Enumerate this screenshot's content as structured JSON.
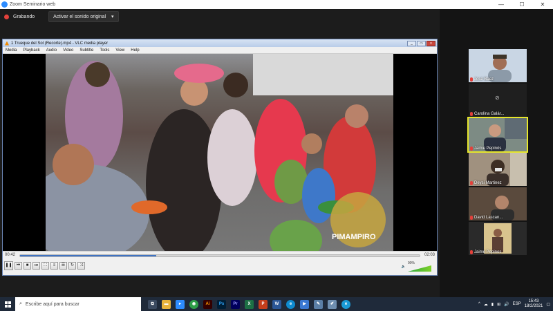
{
  "zoom": {
    "window_title": "Zoom Seminario web",
    "recording_label": "Grabando",
    "original_sound_label": "Activar el sonido original"
  },
  "vlc": {
    "window_title": "1 Trueque del Sol (Recorte).mp4 - VLC media player",
    "menu": [
      "Media",
      "Playback",
      "Audio",
      "Video",
      "Subtitle",
      "Tools",
      "View",
      "Help"
    ],
    "elapsed_time": "00:42",
    "total_time": "02:03",
    "progress": 0.34,
    "volume_label": "90%",
    "volume_level": 0.9,
    "watermark": "PIMAMPIRO"
  },
  "participants": [
    {
      "name": "José Báez",
      "video": true,
      "active": false
    },
    {
      "name": "Carolina Galár...",
      "video": false,
      "active": false
    },
    {
      "name": "Jaime Pepinós",
      "video": true,
      "active": true
    },
    {
      "name": "Deysi Martinez",
      "video": true,
      "active": false
    },
    {
      "name": "David Lascan...",
      "video": true,
      "active": false
    },
    {
      "name": "Jaime Pepinos",
      "video": true,
      "active": false
    }
  ],
  "taskbar": {
    "search_placeholder": "Escribe aquí para buscar",
    "language": "ESP",
    "time": "15:43",
    "date": "18/2/2021"
  },
  "colors": {
    "zoom_blue": "#2d8cff",
    "record_red": "#e3413b",
    "active_speaker": "#e6e62b",
    "vlc_progress": "#3f73c2"
  }
}
